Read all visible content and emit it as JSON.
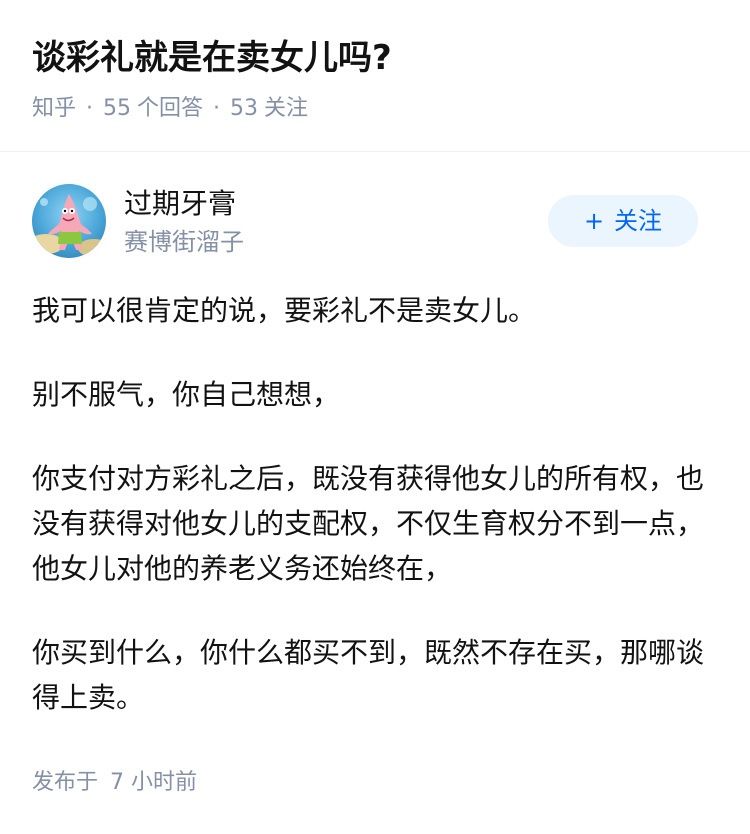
{
  "question": {
    "title": "谈彩礼就是在卖女儿吗?",
    "source": "知乎",
    "answer_count": "55",
    "answer_label": "个回答",
    "follower_count": "53",
    "follower_label": "关注"
  },
  "author": {
    "name": "过期牙膏",
    "bio": "赛博街溜子",
    "avatar_icon": "avatar-patrick-icon",
    "follow_plus": "+",
    "follow_label": "关注"
  },
  "answer": {
    "paragraphs": [
      "我可以很肯定的说，要彩礼不是卖女儿。",
      "别不服气，你自己想想，",
      "你支付对方彩礼之后，既没有获得他女儿的所有权，也没有获得对他女儿的支配权，不仅生育权分不到一点，他女儿对他的养老义务还始终在，",
      "你买到什么，你什么都买不到，既然不存在买，那哪谈得上卖。"
    ],
    "published_label": "发布于",
    "published_time": "7 小时前"
  },
  "colors": {
    "meta_gray": "#8590a6",
    "follow_blue": "#0066ff",
    "follow_bg": "#ebf5fd",
    "text": "#121212"
  }
}
